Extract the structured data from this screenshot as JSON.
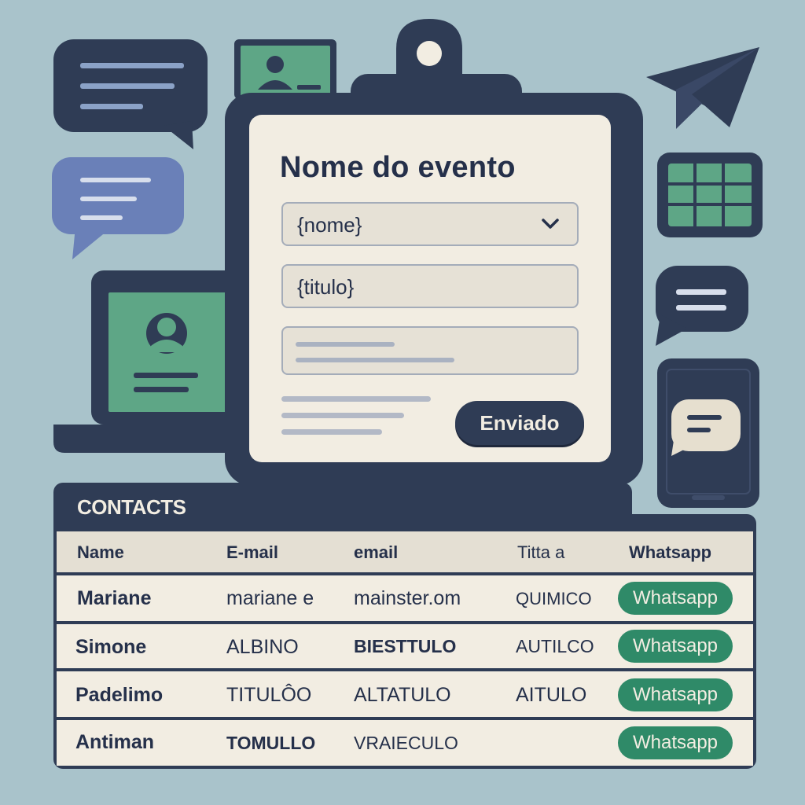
{
  "form": {
    "title": "Nome do evento",
    "field_name": "{nome}",
    "field_title": "{titulo}",
    "send_button": "Enviado"
  },
  "contacts": {
    "title": "CONTACTS",
    "headers": [
      "Name",
      "E-mail",
      "email",
      "Titta a",
      "Whatsapp"
    ],
    "rows": [
      {
        "name": "Mariane",
        "email1": "mariane e",
        "email2": "mainster.om",
        "title": "QUIMICO",
        "action": "Whatsapp"
      },
      {
        "name": "Simone",
        "email1": "ALBINO",
        "email2": "BIESTTULO",
        "title": "AUTILCO",
        "action": "Whatsapp"
      },
      {
        "name": "Padelimo",
        "email1": "TITULÔO",
        "email2": "ALTATULO",
        "title": "AITULO",
        "action": "Whatsapp"
      },
      {
        "name": "Antiman",
        "email1": "TOMULLO",
        "email2": "VRAIECULO",
        "title": "",
        "action": "Whatsapp"
      }
    ]
  },
  "icons": {
    "chat": "chat-bubble-icon",
    "id_card": "id-card-icon",
    "send": "paper-plane-icon",
    "spreadsheet": "spreadsheet-icon",
    "phone": "smartphone-icon",
    "laptop": "laptop-icon"
  },
  "colors": {
    "background": "#a9c3cb",
    "navy": "#2f3c55",
    "paper": "#f2ede2",
    "green": "#2f8a68",
    "blue": "#6a80b8"
  }
}
